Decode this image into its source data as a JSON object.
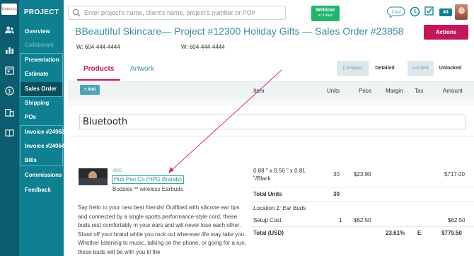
{
  "rail": {
    "logo_text": "Vandelay",
    "icons": [
      "users-icon",
      "bar-chart-icon",
      "calendar-icon",
      "dollar-icon",
      "building-icon",
      "book-icon"
    ]
  },
  "nav": {
    "heading": "PROJECT",
    "items": [
      {
        "label": "Overview"
      },
      {
        "label": "Collaborate"
      },
      {
        "label": "Presentation"
      },
      {
        "label": "Estimate"
      },
      {
        "label": "Sales Order"
      },
      {
        "label": "Shipping"
      },
      {
        "label": "POs"
      },
      {
        "label": "Invoice #24063"
      },
      {
        "label": "Invoice #24064"
      },
      {
        "label": "Bills"
      },
      {
        "label": "Commissions"
      },
      {
        "label": "Feedback"
      }
    ]
  },
  "topbar": {
    "search_placeholder": "Enter project's name, client's name, project's number or PO#",
    "webinar_title": "Webinar",
    "webinar_sub": "in 3 days",
    "chat_label": "Chat",
    "notification_count": "44"
  },
  "header": {
    "client": "BBeautiful Skincare",
    "project": "— Project #12300 Holiday Gifts",
    "order": " — Sales Order #23858",
    "actions_label": "Actions",
    "phone_left": "W: 604-444-4444",
    "phone_right": "W: 604-444-4444"
  },
  "tabs": {
    "products": "Products",
    "artwork": "Artwork",
    "compact": "Compact",
    "detailed": "Detailed",
    "locked": "Locked",
    "unlocked": "Unlocked"
  },
  "table": {
    "add_label": "+ Add",
    "columns": [
      "Item",
      "Units",
      "Price",
      "Margin",
      "Tax",
      "Amount"
    ]
  },
  "section": {
    "name": "Bluetooth"
  },
  "product": {
    "sku": "9805",
    "supplier": "Hub Pen Co (HPG Brands)",
    "name": "Budsies™ wireless Earbuds",
    "description": "Say hello to your new best friends! Outfitted with silicone ear tips and connected by a single sports performance-style cord, these buds rest comfortably in your ears and will never lose each other. Show off your brand while you rock out wherever life may take you. Whether listening to music, talking on the phone, or going for a run, these buds will be with you til the",
    "size_line1": "0.88 \" x 0.56 \" x 0.81",
    "size_line2": "\"/Black",
    "units": "30",
    "price": "$23.90",
    "amount": "$717.00",
    "total_units_label": "Total Units",
    "total_units": "30",
    "location": "Location 1: Ear Buds",
    "setup_label": "Setup Cost",
    "setup_units": "1",
    "setup_price": "$62.50",
    "setup_amount": "$62.50",
    "total_label": "Total (USD)",
    "total_margin": "23.61%",
    "total_tax": "E",
    "total_amount": "$779.50"
  },
  "colors": {
    "rail": "#0b5c6e",
    "nav": "#0e8091",
    "accent": "#c2185b",
    "teal_text": "#3d8fa0",
    "webinar": "#1fb66b"
  }
}
